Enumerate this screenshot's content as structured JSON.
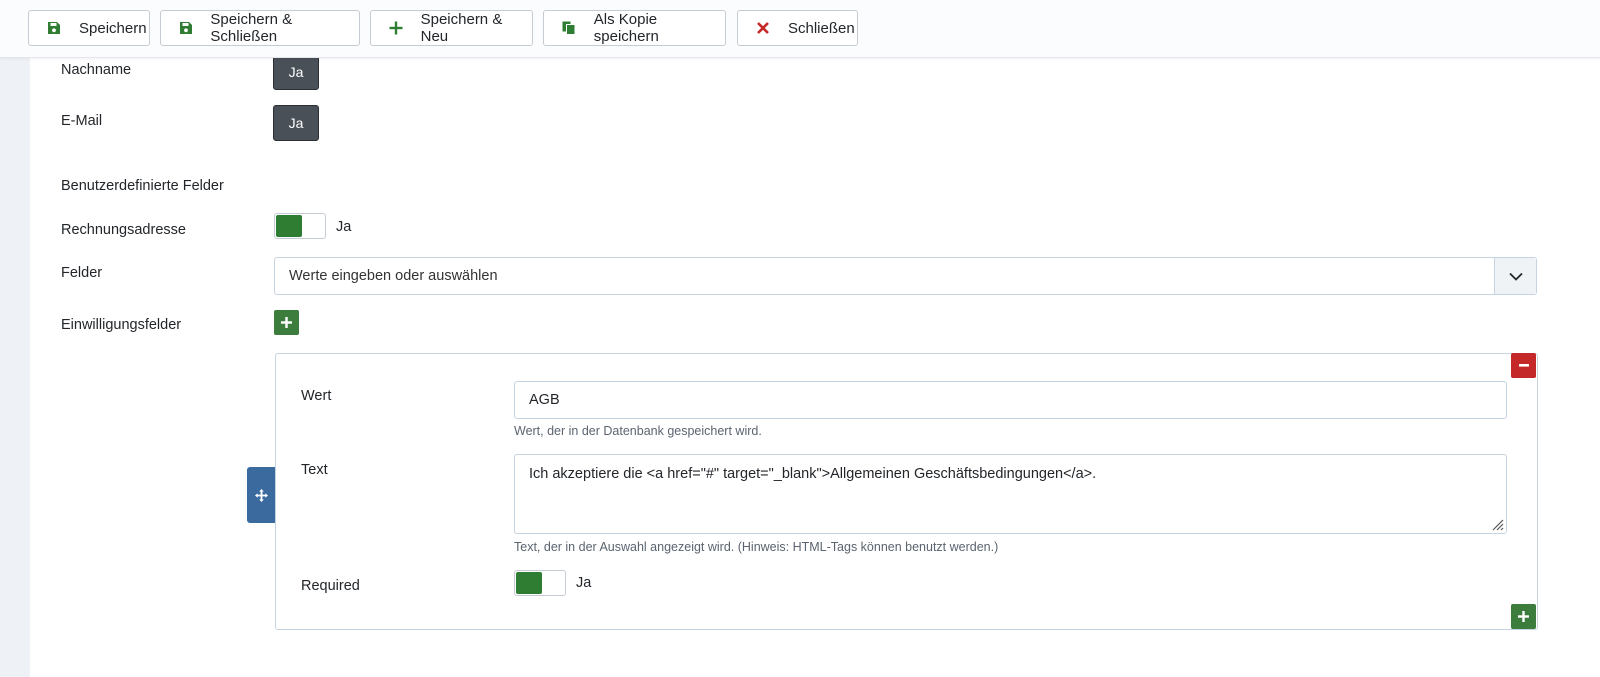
{
  "toolbar": {
    "save": "Speichern",
    "save_close": "Speichern & Schließen",
    "save_new": "Speichern & Neu",
    "save_copy": "Als Kopie speichern",
    "close": "Schließen"
  },
  "form": {
    "nachname": {
      "label": "Nachname",
      "value": "Ja"
    },
    "email": {
      "label": "E-Mail",
      "value": "Ja"
    },
    "custom_fields_label": "Benutzerdefinierte Felder",
    "rechnungsadresse": {
      "label": "Rechnungsadresse",
      "value": "Ja"
    },
    "felder": {
      "label": "Felder",
      "placeholder": "Werte eingeben oder auswählen"
    },
    "einwilligung": {
      "label": "Einwilligungsfelder"
    }
  },
  "subform": {
    "wert": {
      "label": "Wert",
      "value": "AGB",
      "help": "Wert, der in der Datenbank gespeichert wird."
    },
    "text": {
      "label": "Text",
      "value": "Ich akzeptiere die <a href=\"#\" target=\"_blank\">Allgemeinen Geschäftsbedingungen</a>.",
      "help": "Text, der in der Auswahl angezeigt wird. (Hinweis: HTML-Tags können benutzt werden.)"
    },
    "required": {
      "label": "Required",
      "value": "Ja"
    }
  },
  "icons": {
    "save": "floppy-disk-icon",
    "add": "plus-icon",
    "copy": "copy-icon",
    "close": "x-icon",
    "remove": "minus-icon",
    "move": "move-arrows-icon",
    "caret": "chevron-down-icon"
  },
  "colors": {
    "accent_green": "#2e7d32",
    "danger_red": "#c52828",
    "move_blue": "#3a6a9e",
    "dark_button": "#495057"
  }
}
